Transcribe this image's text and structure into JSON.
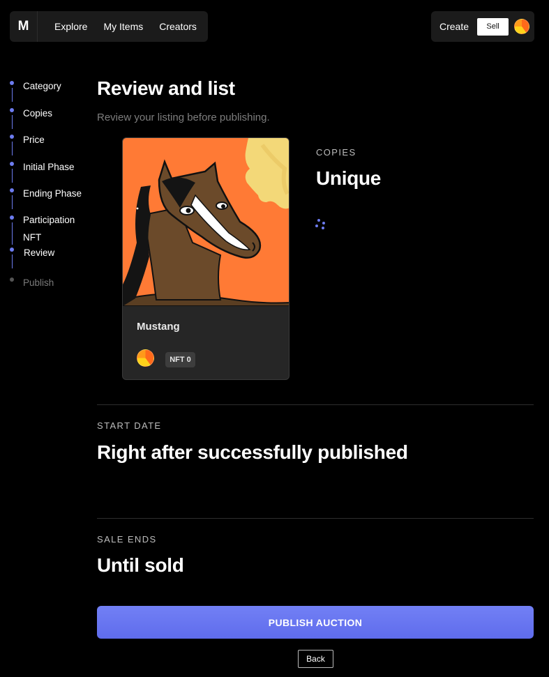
{
  "nav": {
    "logo": "M",
    "links": [
      "Explore",
      "My Items",
      "Creators"
    ],
    "create_label": "Create",
    "sell_label": "Sell"
  },
  "stepper": {
    "steps": [
      {
        "label": "Category",
        "state": "done"
      },
      {
        "label": "Copies",
        "state": "done"
      },
      {
        "label": "Price",
        "state": "done"
      },
      {
        "label": "Initial Phase",
        "state": "done"
      },
      {
        "label": "Ending Phase",
        "state": "done"
      },
      {
        "label": "Participation NFT",
        "state": "done"
      },
      {
        "label": "Review",
        "state": "current"
      },
      {
        "label": "Publish",
        "state": "pending"
      }
    ]
  },
  "main": {
    "title": "Review and list",
    "subtitle": "Review your listing before publishing.",
    "card": {
      "name": "Mustang",
      "badge": "NFT 0"
    },
    "copies": {
      "kicker": "COPIES",
      "value": "Unique"
    },
    "start_date": {
      "kicker": "START DATE",
      "value": "Right after successfully published"
    },
    "sale_ends": {
      "kicker": "SALE ENDS",
      "value": "Until sold"
    },
    "publish_label": "PUBLISH AUCTION",
    "back_label": "Back"
  },
  "colors": {
    "accent": "#6d7cf0",
    "background": "#000000",
    "panel": "#1b1b1b",
    "art_background": "#ff7a35"
  }
}
